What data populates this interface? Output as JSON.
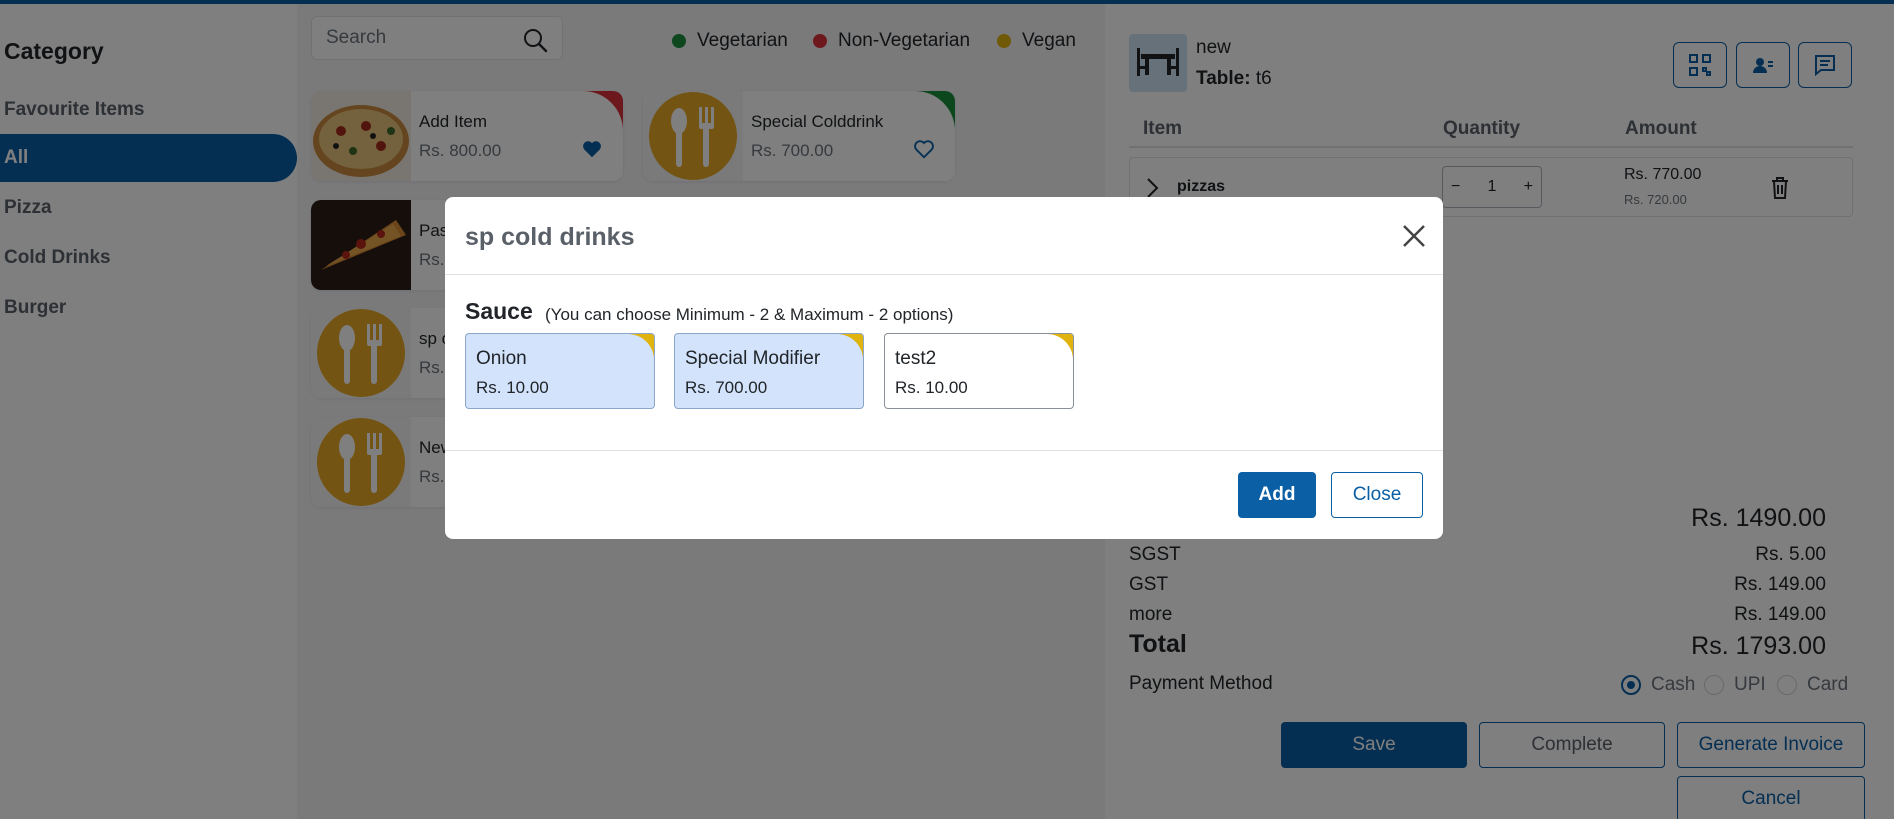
{
  "colors": {
    "brand": "#0b5fa5",
    "vegetarian": "#1a8f3c",
    "non_vegetarian": "#d9303b",
    "vegan": "#e0b30f",
    "modifier_selected": "#d2e3fb"
  },
  "sidebar": {
    "title": "Category",
    "items": [
      {
        "label": "Favourite Items",
        "active": false
      },
      {
        "label": "All",
        "active": true
      },
      {
        "label": "Pizza",
        "active": false
      },
      {
        "label": "Cold Drinks",
        "active": false
      },
      {
        "label": "Burger",
        "active": false
      }
    ]
  },
  "menu": {
    "search_placeholder": "Search",
    "search_icon": "search-icon",
    "legend": [
      {
        "label": "Vegetarian",
        "color": "#1a8f3c"
      },
      {
        "label": "Non-Vegetarian",
        "color": "#d9303b"
      },
      {
        "label": "Vegan",
        "color": "#e0b30f"
      }
    ],
    "items": [
      {
        "name": "Add Item",
        "price": "Rs. 800.00",
        "image": "pizza-image",
        "diet": "non-vegetarian",
        "favourite": true
      },
      {
        "name": "Special Colddrink",
        "price": "Rs. 700.00",
        "image": "cutlery-placeholder-icon",
        "diet": "vegetarian",
        "favourite": false
      },
      {
        "name": "Pas",
        "price": "Rs.",
        "image": "pizza-slice-image"
      },
      {
        "name": "sp c",
        "price": "Rs.",
        "image": "cutlery-placeholder-icon"
      },
      {
        "name": "New",
        "price": "Rs.",
        "image": "cutlery-placeholder-icon"
      }
    ]
  },
  "order": {
    "name": "new",
    "table_label": "Table:",
    "table_value": "t6",
    "tools": [
      "qr-code-icon",
      "customer-card-icon",
      "chat-icon"
    ],
    "columns": {
      "item": "Item",
      "quantity": "Quantity",
      "amount": "Amount"
    },
    "line_items": [
      {
        "name": "pizzas",
        "quantity": "1",
        "amount": "Rs. 770.00",
        "base_amount": "Rs. 720.00"
      }
    ],
    "subtotal": "Rs. 1490.00",
    "taxes": [
      {
        "label": "SGST",
        "value": "Rs. 5.00"
      },
      {
        "label": "GST",
        "value": "Rs. 149.00"
      },
      {
        "label": "more",
        "value": "Rs. 149.00"
      }
    ],
    "total_label": "Total",
    "total_value": "Rs. 1793.00",
    "payment": {
      "label": "Payment Method",
      "options": [
        {
          "label": "Cash",
          "selected": true
        },
        {
          "label": "UPI",
          "selected": false
        },
        {
          "label": "Card",
          "selected": false
        }
      ]
    },
    "buttons": {
      "save": "Save",
      "complete": "Complete",
      "generate_invoice": "Generate Invoice",
      "cancel": "Cancel"
    }
  },
  "modal": {
    "title": "sp cold drinks",
    "group_title": "Sauce",
    "group_hint": "(You can choose Minimum - 2 & Maximum - 2 options)",
    "options": [
      {
        "name": "Onion",
        "price": "Rs. 10.00",
        "selected": true
      },
      {
        "name": "Special Modifier",
        "price": "Rs. 700.00",
        "selected": true
      },
      {
        "name": "test2",
        "price": "Rs. 10.00",
        "selected": false
      }
    ],
    "add_label": "Add",
    "close_label": "Close"
  }
}
